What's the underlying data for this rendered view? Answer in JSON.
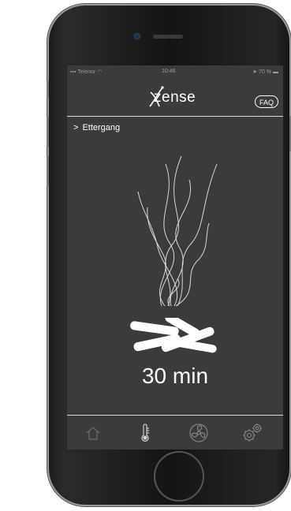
{
  "status_bar": {
    "carrier": "Telenor",
    "time": "10:46",
    "battery": "70 %"
  },
  "header": {
    "brand": "zense",
    "faq_label": "FAQ"
  },
  "breadcrumb": {
    "label": "Ettergang"
  },
  "main": {
    "duration": "30 min"
  },
  "tabbar": {
    "items": [
      {
        "icon": "home-icon",
        "label": ""
      },
      {
        "icon": "thermometer-icon",
        "label": ""
      },
      {
        "icon": "fan-icon",
        "label": ""
      },
      {
        "icon": "settings-gears-icon",
        "label": ""
      }
    ]
  },
  "colors": {
    "screen_bg": "#3b3b3b",
    "foreground": "#ffffff",
    "inactive_icon": "#6a6a6a"
  }
}
